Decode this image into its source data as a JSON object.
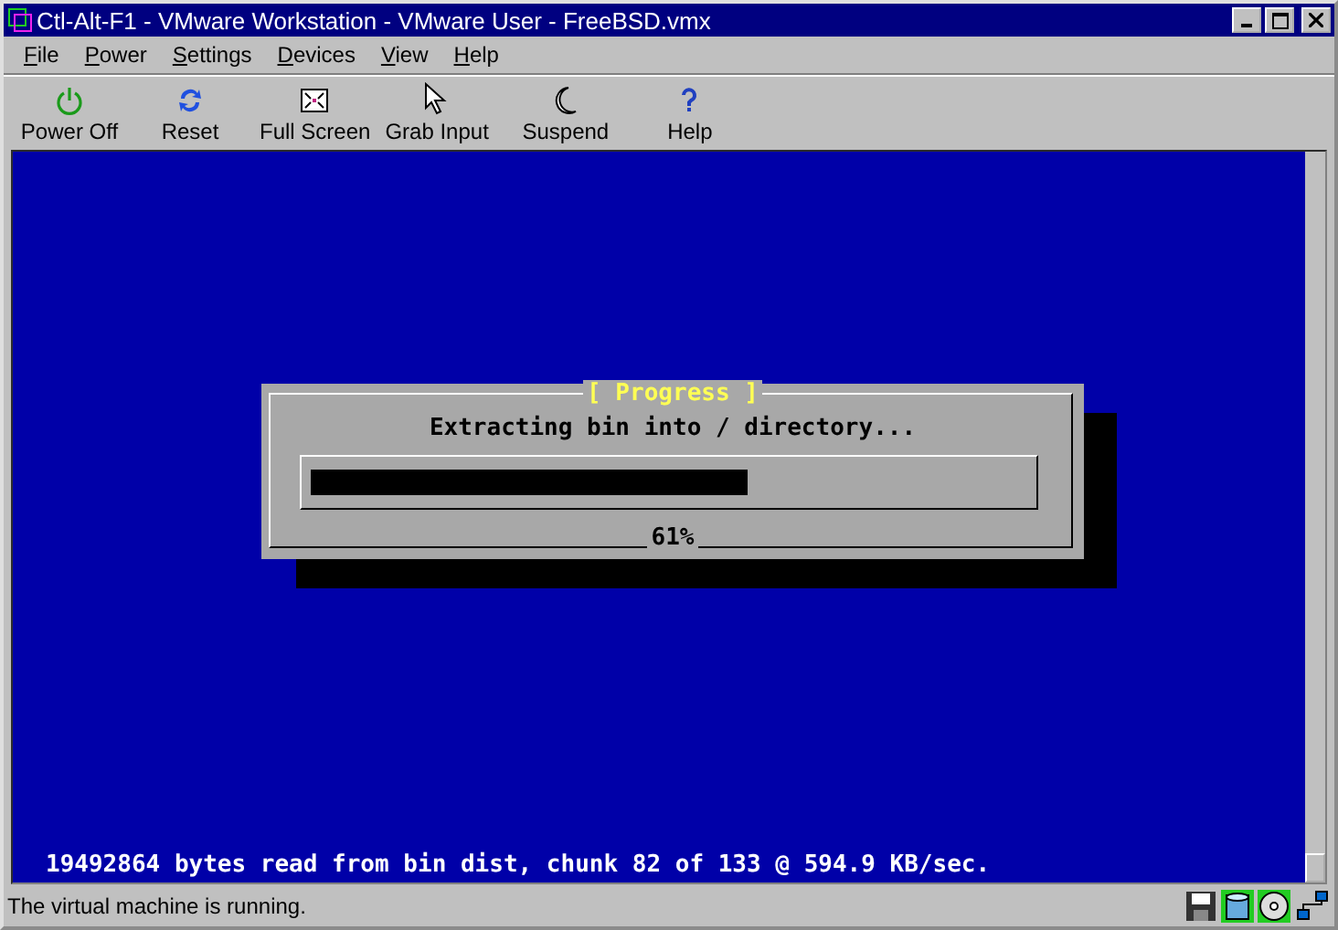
{
  "window": {
    "title": "Ctl-Alt-F1 - VMware Workstation - VMware User - FreeBSD.vmx"
  },
  "menu": [
    "File",
    "Power",
    "Settings",
    "Devices",
    "View",
    "Help"
  ],
  "toolbar": [
    {
      "kind": "power",
      "label": "Power Off"
    },
    {
      "kind": "reset",
      "label": "Reset"
    },
    {
      "kind": "fullscreen",
      "label": "Full Screen"
    },
    {
      "kind": "grab",
      "label": "Grab Input"
    },
    {
      "kind": "suspend",
      "label": "Suspend"
    },
    {
      "kind": "help",
      "label": "Help"
    }
  ],
  "console": {
    "dialog": {
      "title": "[ Progress ]",
      "message": "Extracting bin into / directory...",
      "level": 0.61,
      "percent": "61%"
    },
    "status_line": "19492864 bytes read from bin dist, chunk 82 of 133 @ 594.9 KB/sec."
  },
  "status_bar": {
    "text": "The virtual machine is running."
  }
}
